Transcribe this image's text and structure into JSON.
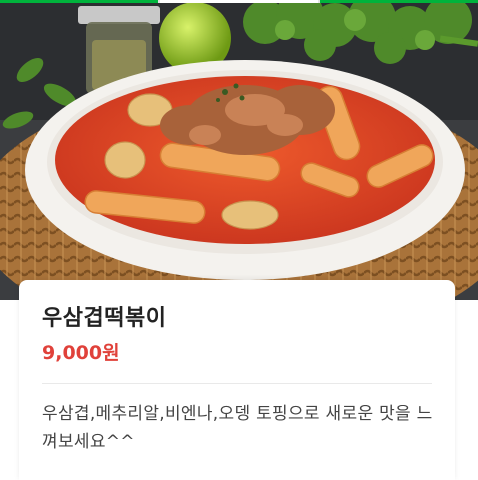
{
  "theme": {
    "accent": "#00b33c",
    "price_color": "#e0413a"
  },
  "slider": {
    "total_slides": 3,
    "active_index": 1
  },
  "image": {
    "subject": "rabokki-dish-photo"
  },
  "menu_item": {
    "name": "우삼겹떡볶이",
    "price": "9,000원",
    "description": "우삼겹,메추리알,비엔나,오뎅 토핑으로 새로운 맛을 느껴보세요^^"
  }
}
